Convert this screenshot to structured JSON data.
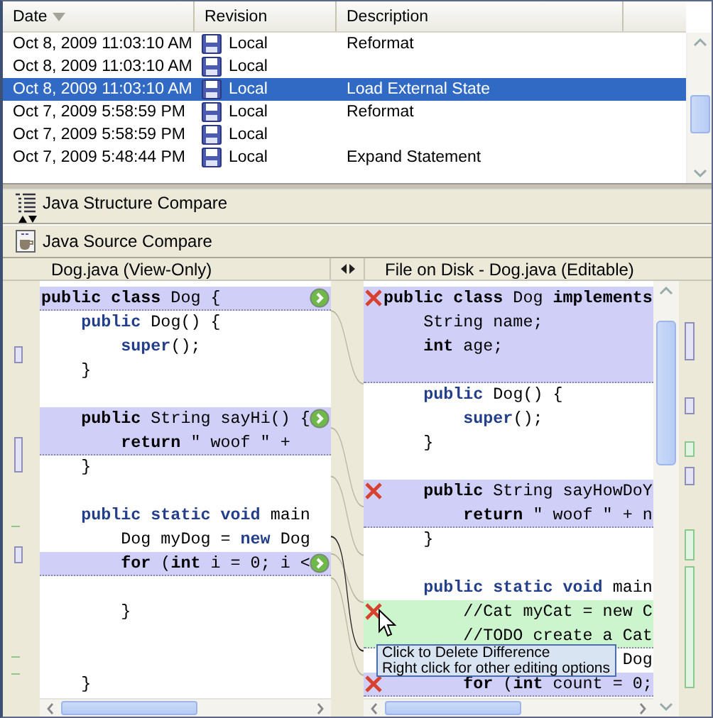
{
  "history": {
    "columns": [
      {
        "label": "Date",
        "sorted": true
      },
      {
        "label": "Revision",
        "sorted": false
      },
      {
        "label": "Description",
        "sorted": false
      }
    ],
    "rows": [
      {
        "date": "Oct 8, 2009 11:03:10 AM",
        "revision": "Local",
        "description": "Reformat",
        "selected": false
      },
      {
        "date": "Oct 8, 2009 11:03:10 AM",
        "revision": "Local",
        "selected": false
      },
      {
        "date": "Oct 8, 2009 11:03:10 AM",
        "revision": "Local",
        "description": "Load External State",
        "selected": true
      },
      {
        "date": "Oct 7, 2009 5:58:59 PM",
        "revision": "Local",
        "description": "Reformat",
        "selected": false
      },
      {
        "date": "Oct 7, 2009 5:58:59 PM",
        "revision": "Local",
        "selected": false
      },
      {
        "date": "Oct 7, 2009 5:48:44 PM",
        "revision": "Local",
        "description": "Expand Statement",
        "selected": false
      }
    ]
  },
  "structure_compare": {
    "title": "Java Structure Compare"
  },
  "source_compare": {
    "title": "Java Source Compare"
  },
  "left": {
    "title": "Dog.java (View-Only)",
    "lines": [
      {
        "kind": "changed",
        "button": {
          "kind": "copy"
        },
        "code": [
          {
            "kind": "strong",
            "text": "public class"
          },
          {
            "kind": "plain",
            "text": " Dog {"
          }
        ]
      },
      {
        "kind": "unchanged",
        "code": [
          {
            "kind": "keyword",
            "text": "    public"
          },
          {
            "kind": "plain",
            "text": " Dog() {"
          }
        ]
      },
      {
        "kind": "unchanged",
        "code": [
          {
            "kind": "keyword",
            "text": "        super"
          },
          {
            "kind": "plain",
            "text": "();"
          }
        ]
      },
      {
        "kind": "unchanged",
        "code": [
          {
            "kind": "plain",
            "text": "    }"
          }
        ]
      },
      {
        "kind": "unchanged"
      },
      {
        "kind": "changed",
        "button": {
          "kind": "copy"
        },
        "code": [
          {
            "kind": "strong",
            "text": "    public"
          },
          {
            "kind": "plain",
            "text": " String sayHi() {"
          }
        ]
      },
      {
        "kind": "changed",
        "code": [
          {
            "kind": "strong",
            "text": "        return"
          },
          {
            "kind": "plain",
            "text": " \" woof \" +"
          }
        ]
      },
      {
        "kind": "unchanged",
        "code": [
          {
            "kind": "plain",
            "text": "    }"
          }
        ]
      },
      {
        "kind": "unchanged"
      },
      {
        "kind": "unchanged",
        "code": [
          {
            "kind": "keyword",
            "text": "    public static void"
          },
          {
            "kind": "plain",
            "text": " main"
          }
        ]
      },
      {
        "kind": "unchanged",
        "code": [
          {
            "kind": "plain",
            "text": "        Dog myDog = "
          },
          {
            "kind": "keyword",
            "text": "new"
          },
          {
            "kind": "plain",
            "text": " Dog"
          }
        ]
      },
      {
        "kind": "changed",
        "button": {
          "kind": "copy"
        },
        "code": [
          {
            "kind": "strong",
            "text": "        for"
          },
          {
            "kind": "plain",
            "text": " ("
          },
          {
            "kind": "strong",
            "text": "int"
          },
          {
            "kind": "plain",
            "text": " i = 0; i <"
          }
        ]
      },
      {
        "kind": "unchanged"
      },
      {
        "kind": "unchanged",
        "code": [
          {
            "kind": "plain",
            "text": "        }"
          }
        ]
      },
      {
        "kind": "unchanged"
      },
      {
        "kind": "unchanged"
      },
      {
        "kind": "unchanged",
        "code": [
          {
            "kind": "plain",
            "text": "    }"
          }
        ]
      }
    ]
  },
  "right": {
    "title": "File on Disk - Dog.java (Editable)",
    "lines": [
      {
        "kind": "changed",
        "button": {
          "kind": "delete"
        },
        "code": [
          {
            "kind": "strong",
            "text": "public class"
          },
          {
            "kind": "plain",
            "text": " Dog "
          },
          {
            "kind": "strong",
            "text": "implements"
          }
        ]
      },
      {
        "kind": "changed",
        "code": [
          {
            "kind": "plain",
            "text": "    String name;"
          }
        ]
      },
      {
        "kind": "changed",
        "code": [
          {
            "kind": "strong",
            "text": "    int"
          },
          {
            "kind": "plain",
            "text": " age;"
          }
        ]
      },
      {
        "kind": "changed"
      },
      {
        "kind": "unchanged",
        "code": [
          {
            "kind": "keyword",
            "text": "    public"
          },
          {
            "kind": "plain",
            "text": " Dog() {"
          }
        ]
      },
      {
        "kind": "unchanged",
        "code": [
          {
            "kind": "keyword",
            "text": "        super"
          },
          {
            "kind": "plain",
            "text": "();"
          }
        ]
      },
      {
        "kind": "unchanged",
        "code": [
          {
            "kind": "plain",
            "text": "    }"
          }
        ]
      },
      {
        "kind": "unchanged"
      },
      {
        "kind": "changed",
        "button": {
          "kind": "delete"
        },
        "code": [
          {
            "kind": "strong",
            "text": "    public"
          },
          {
            "kind": "plain",
            "text": " String sayHowDoY"
          }
        ]
      },
      {
        "kind": "changed",
        "code": [
          {
            "kind": "strong",
            "text": "        return"
          },
          {
            "kind": "plain",
            "text": " \" woof \" + n"
          }
        ]
      },
      {
        "kind": "unchanged",
        "code": [
          {
            "kind": "plain",
            "text": "    }"
          }
        ]
      },
      {
        "kind": "unchanged"
      },
      {
        "kind": "unchanged",
        "code": [
          {
            "kind": "keyword",
            "text": "    public static void"
          },
          {
            "kind": "plain",
            "text": " main"
          }
        ]
      },
      {
        "kind": "added",
        "button": {
          "kind": "delete"
        },
        "code": [
          {
            "kind": "plain",
            "text": "        //Cat myCat = new C"
          }
        ]
      },
      {
        "kind": "added",
        "code": [
          {
            "kind": "plain",
            "text": "        //TODO create a Cat"
          }
        ]
      },
      {
        "kind": "unchanged",
        "code": [
          {
            "kind": "plain",
            "text": "                        Dog"
          }
        ]
      },
      {
        "kind": "changed",
        "button": {
          "kind": "delete"
        },
        "code": [
          {
            "kind": "strong",
            "text": "        for"
          },
          {
            "kind": "plain",
            "text": " ("
          },
          {
            "kind": "strong",
            "text": "int"
          },
          {
            "kind": "plain",
            "text": " count = 0;"
          }
        ]
      }
    ]
  },
  "tooltip": {
    "lines": [
      "Click to Delete Difference",
      "Right click for other editing options"
    ]
  }
}
